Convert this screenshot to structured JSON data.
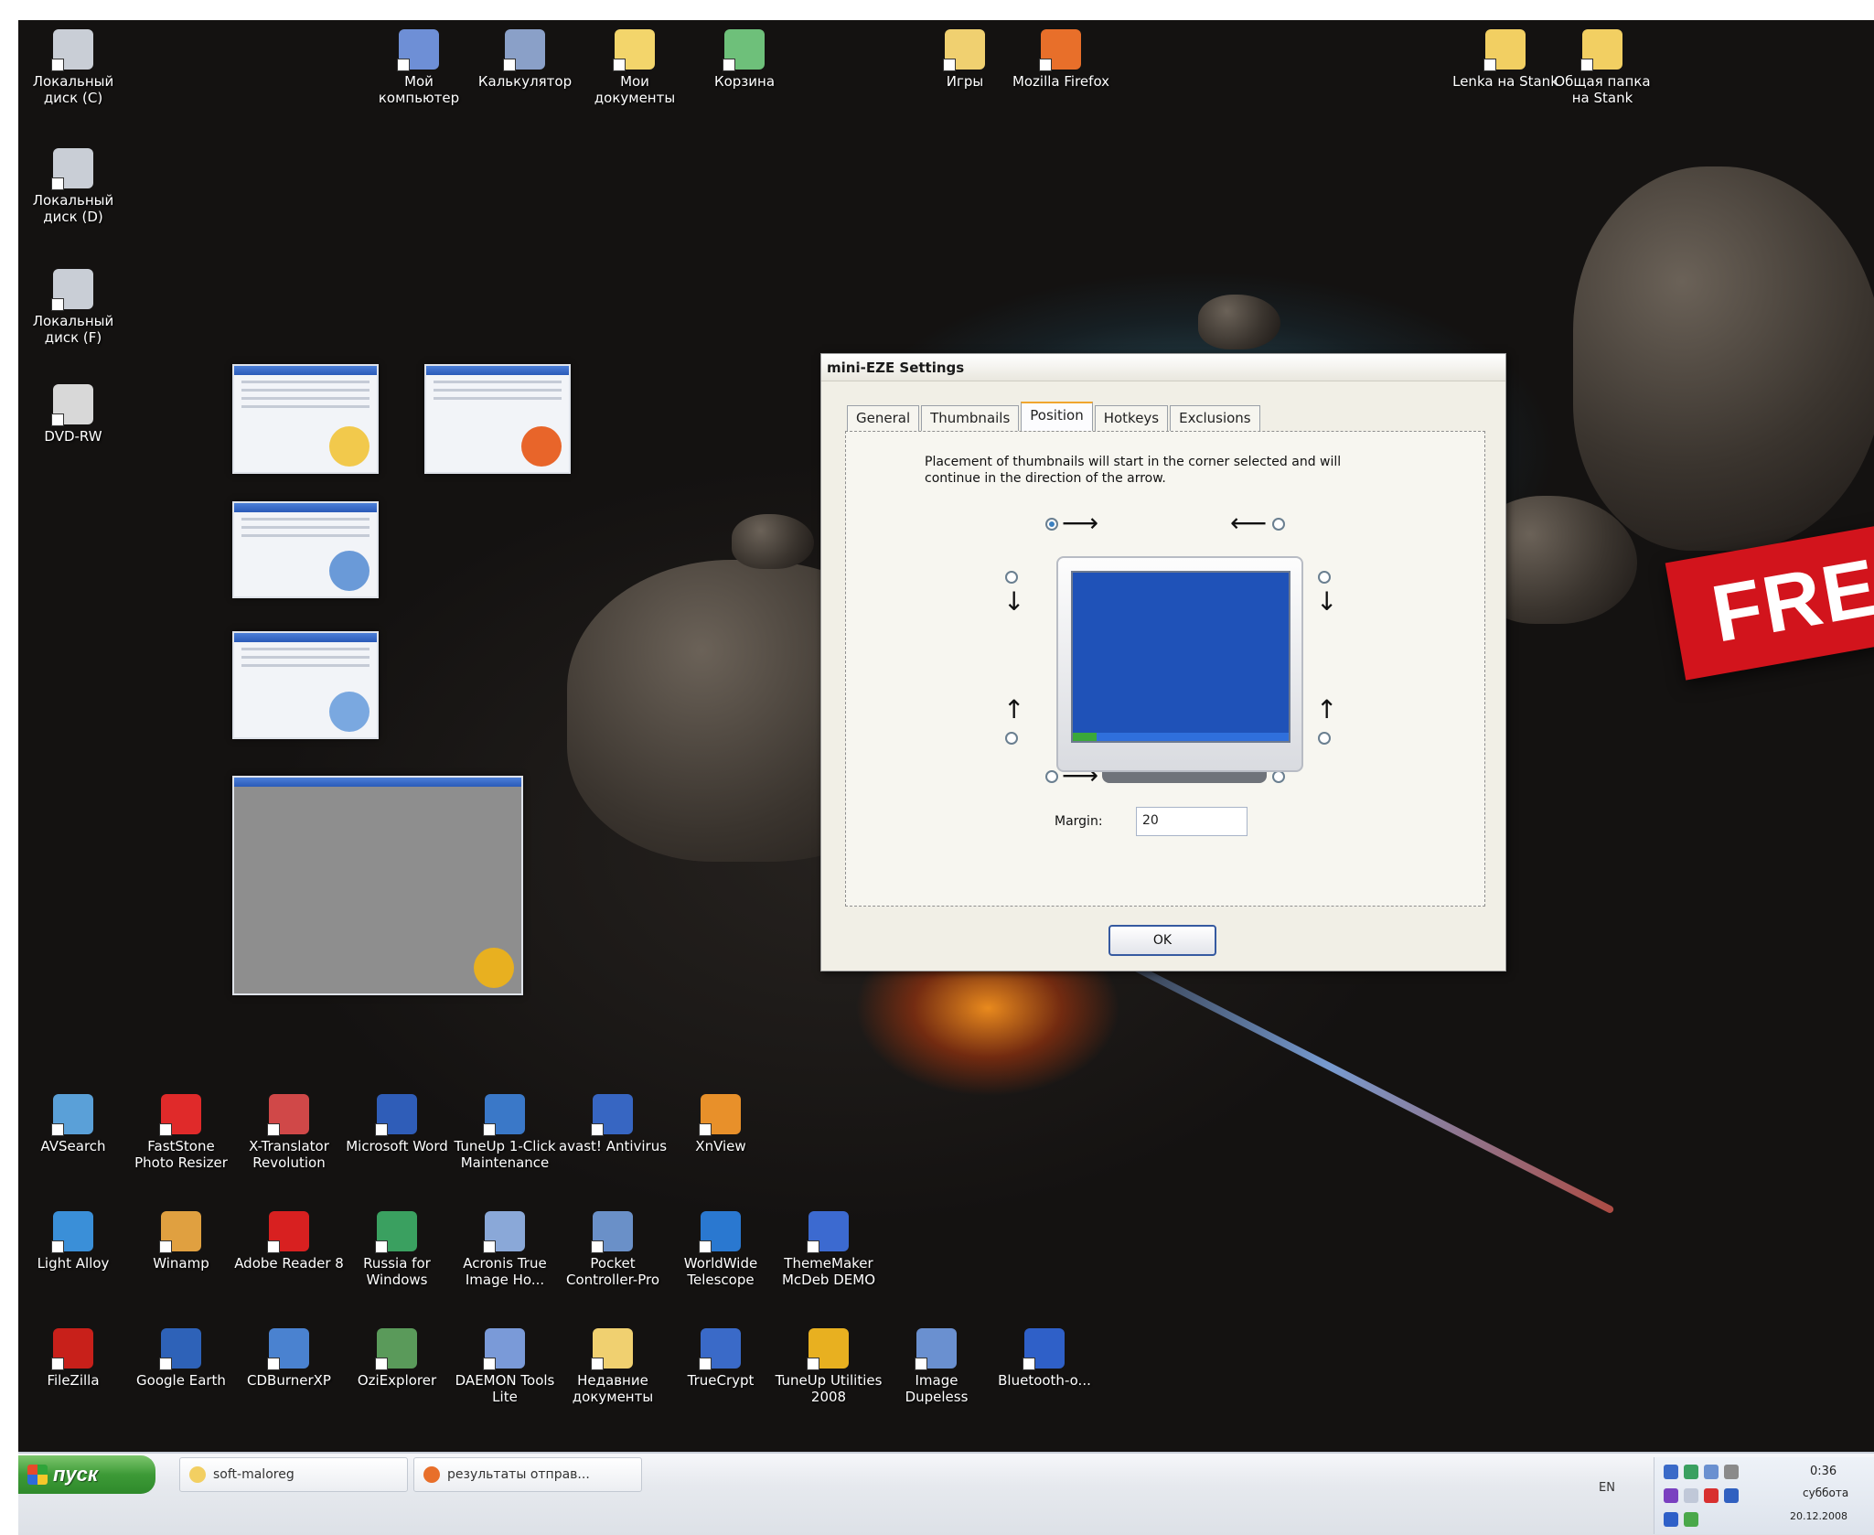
{
  "desktop": {
    "top_icons": [
      {
        "label": "Локальный диск (C)",
        "icon": "hard-drive-icon",
        "color": "#c9ced6"
      },
      {
        "label": "Мой компьютер",
        "icon": "my-computer-icon",
        "color": "#6e8fd6"
      },
      {
        "label": "Калькулятор",
        "icon": "calculator-icon",
        "color": "#8aa0c8"
      },
      {
        "label": "Мои документы",
        "icon": "my-documents-icon",
        "color": "#f3d56b"
      },
      {
        "label": "Корзина",
        "icon": "recycle-bin-icon",
        "color": "#6ec07a"
      },
      {
        "label": "Игры",
        "icon": "folder-icon",
        "color": "#f0d070"
      },
      {
        "label": "Mozilla Firefox",
        "icon": "firefox-icon",
        "color": "#e86f2a"
      },
      {
        "label": "Lenka на Stank",
        "icon": "network-folder-icon",
        "color": "#f2cf62"
      },
      {
        "label": "Общая папка на Stank",
        "icon": "network-folder-icon",
        "color": "#f2cf62"
      }
    ],
    "left_icons": [
      {
        "label": "Локальный диск (D)",
        "icon": "hard-drive-icon",
        "color": "#c9ced6"
      },
      {
        "label": "Локальный диск (F)",
        "icon": "hard-drive-icon",
        "color": "#c9ced6"
      },
      {
        "label": "DVD-RW",
        "icon": "dvd-drive-icon",
        "color": "#d8d8d8"
      }
    ],
    "bottom_icons": [
      {
        "label": "AVSearch",
        "icon": "avsearch-icon",
        "color": "#5aa0d8"
      },
      {
        "label": "FastStone Photo Resizer",
        "icon": "faststone-icon",
        "color": "#e02a2a"
      },
      {
        "label": "X-Translator Revolution",
        "icon": "translator-icon",
        "color": "#d04848"
      },
      {
        "label": "Microsoft Word",
        "icon": "word-icon",
        "color": "#2f5db8"
      },
      {
        "label": "TuneUp 1-Click Maintenance",
        "icon": "tuneup-icon",
        "color": "#3a78c8"
      },
      {
        "label": "avast! Antivirus",
        "icon": "avast-icon",
        "color": "#3766c2"
      },
      {
        "label": "XnView",
        "icon": "xnview-icon",
        "color": "#e8902a"
      },
      {
        "label": "Light Alloy",
        "icon": "light-alloy-icon",
        "color": "#3a8fd8"
      },
      {
        "label": "Winamp",
        "icon": "winamp-icon",
        "color": "#e0a040"
      },
      {
        "label": "Adobe Reader 8",
        "icon": "adobe-reader-icon",
        "color": "#d82020"
      },
      {
        "label": "Russia for Windows",
        "icon": "russia-icon",
        "color": "#3aa060"
      },
      {
        "label": "Acronis True Image Ho...",
        "icon": "acronis-icon",
        "color": "#8aa8d8"
      },
      {
        "label": "Pocket Controller-Pro",
        "icon": "pocket-controller-icon",
        "color": "#6a90c8"
      },
      {
        "label": "WorldWide Telescope",
        "icon": "telescope-icon",
        "color": "#2a78d0"
      },
      {
        "label": "ThemeMaker McDeb DEMO",
        "icon": "thememaker-icon",
        "color": "#3c6ad0"
      },
      {
        "label": "FileZilla",
        "icon": "filezilla-icon",
        "color": "#c8201a"
      },
      {
        "label": "Google Earth",
        "icon": "google-earth-icon",
        "color": "#2e62b8"
      },
      {
        "label": "CDBurnerXP",
        "icon": "cdburner-icon",
        "color": "#4a82d0"
      },
      {
        "label": "OziExplorer",
        "icon": "oziexplorer-icon",
        "color": "#5a9a5a"
      },
      {
        "label": "DAEMON Tools Lite",
        "icon": "daemon-tools-icon",
        "color": "#7a9ad8"
      },
      {
        "label": "Недавние документы",
        "icon": "recent-docs-icon",
        "color": "#f0d070"
      },
      {
        "label": "TrueCrypt",
        "icon": "truecrypt-icon",
        "color": "#3a6ac8"
      },
      {
        "label": "TuneUp Utilities 2008",
        "icon": "tuneup-utilities-icon",
        "color": "#e8b020"
      },
      {
        "label": "Image Dupeless",
        "icon": "image-dupeless-icon",
        "color": "#6a90d0"
      },
      {
        "label": "Bluetooth-o...",
        "icon": "bluetooth-icon",
        "color": "#2f60c8"
      }
    ],
    "thumbnails": [
      {
        "badge_color": "#f2c94c"
      },
      {
        "badge_color": "#e8652a"
      },
      {
        "badge_color": "#6a9ad8"
      },
      {
        "badge_color": "#7aa8e0"
      },
      {
        "badge_color": "#e8b020"
      }
    ],
    "banner_text": "FREE"
  },
  "dialog": {
    "title": "mini-EZE Settings",
    "tabs": [
      "General",
      "Thumbnails",
      "Position",
      "Hotkeys",
      "Exclusions"
    ],
    "active_tab": "Position",
    "description": "Placement of thumbnails will start in the corner selected and will continue in the direction of the arrow.",
    "selected_corner": "top-left",
    "margin_label": "Margin:",
    "margin_value": "20",
    "ok_label": "OK"
  },
  "taskbar": {
    "start_label": "пуск",
    "tasks": [
      {
        "label": "soft-maloreg",
        "icon": "folder-icon",
        "color": "#f2cf62"
      },
      {
        "label": "результаты отправ...",
        "icon": "firefox-icon",
        "color": "#e86f2a"
      }
    ],
    "language": "EN",
    "clock_time": "0:36",
    "clock_day": "суббота",
    "clock_date": "20.12.2008"
  },
  "colors": {
    "dialog_bg": "#f1efe6",
    "screen_blue": "#1f52b8",
    "banner_red": "#d2141c",
    "start_green": "#3d9a37"
  }
}
